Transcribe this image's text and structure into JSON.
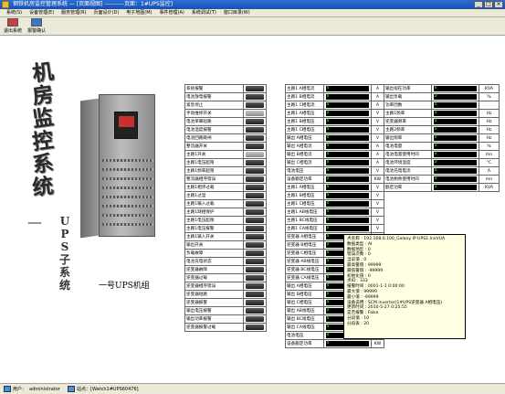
{
  "window": {
    "title": "钢铁机房监控管理系统 — [页面视图] ----------页面：1#UPS监控]",
    "min_label": "_",
    "max_label": "□",
    "close_label": "×"
  },
  "menu": [
    "系统(S)",
    "设备管理(E)",
    "服务管理(R)",
    "页面设计(D)",
    "电子地图(M)",
    "事件管理(A)",
    "系统调试(T)",
    "窗口目录(W)"
  ],
  "toolbar": {
    "exit_label": "退出系统",
    "alarm_label": "报警确认"
  },
  "vertical_title": [
    "机",
    "房",
    "监",
    "控",
    "系",
    "统"
  ],
  "dash": "—",
  "vertical_subtitle": [
    "U",
    "P",
    "S",
    "子",
    "系",
    "统"
  ],
  "ups_label": "一号UPS机组",
  "status_items": [
    "系统报警",
    "电池放电报警",
    "紧急停止",
    "手动维修开关",
    "电池单串短路",
    "电池温度报警",
    "电池回路跳闸",
    "整流器开关",
    "主路1开关",
    "主路1电压超限",
    "主路1频率超限",
    "整流器相序错误",
    "主路1相序过载",
    "主路1过温",
    "主路1输入过载",
    "主路1缺相保护",
    "主路1电压超限",
    "主路1电压报警",
    "主路1输入开关",
    "输出开关",
    "负载故障",
    "电池充电状态",
    "逆变器故障",
    "逆变器过载",
    "逆变器相序错误",
    "逆变器短路",
    "逆变器报警",
    "输出电压报警",
    "输出功率报警",
    "逆变器报警过载"
  ],
  "status_colors": [
    "dark",
    "dark",
    "dark",
    "gray",
    "dark",
    "dark",
    "dark",
    "dark",
    "gray",
    "dark",
    "dark",
    "dark",
    "dark",
    "dark",
    "dark",
    "dark",
    "dark",
    "dark",
    "dark",
    "dark",
    "dark",
    "dark",
    "dark",
    "dark",
    "dark",
    "dark",
    "dark",
    "dark",
    "dark",
    "dark"
  ],
  "meas_rows": [
    {
      "name": "主路1 A相电流",
      "value": "0",
      "unit": "A",
      "name2": "输出视在功率",
      "value2": "0",
      "unit2": "KVA"
    },
    {
      "name": "主路1 B相电流",
      "value": "0",
      "unit": "A",
      "name2": "输出负载",
      "value2": "0",
      "unit2": "%"
    },
    {
      "name": "主路1 C相电流",
      "value": "0",
      "unit": "A",
      "name2": "功率因数",
      "value2": "0",
      "unit2": ""
    },
    {
      "name": "主路1 A相电压",
      "value": "0",
      "unit": "V",
      "name2": "主路1频率",
      "value2": "0",
      "unit2": "Hz"
    },
    {
      "name": "主路1 B相电压",
      "value": "0",
      "unit": "V",
      "name2": "逆变器频率",
      "value2": "0",
      "unit2": "Hz"
    },
    {
      "name": "主路1 C相电压",
      "value": "0",
      "unit": "V",
      "name2": "主路2频率",
      "value2": "0",
      "unit2": "Hz"
    },
    {
      "name": "输出 A相电压",
      "value": "0",
      "unit": "V",
      "name2": "输出频率",
      "value2": "0",
      "unit2": "Hz"
    },
    {
      "name": "输出 A相电流",
      "value": "0",
      "unit": "A",
      "name2": "电池电量",
      "value2": "0",
      "unit2": "%"
    },
    {
      "name": "输出 B相电流",
      "value": "0",
      "unit": "A",
      "name2": "电池电量使用时间",
      "value2": "0",
      "unit2": "mn"
    },
    {
      "name": "输出 C相电流",
      "value": "0",
      "unit": "A",
      "name2": "电池环境温度",
      "value2": "0",
      "unit2": "°C"
    },
    {
      "name": "电池电压",
      "value": "0",
      "unit": "V",
      "name2": "电池充电电流",
      "value2": "0",
      "unit2": "A"
    },
    {
      "name": "设备额定功率",
      "value": "0",
      "unit": "KW",
      "name2": "电池剩余使用时间",
      "value2": "0",
      "unit2": "mn"
    },
    {
      "name": "主路1 A相电压",
      "value": "0",
      "unit": "V",
      "name2": "额定功率",
      "value2": "0",
      "unit2": "KVA"
    },
    {
      "name": "主路1 B相电压",
      "value": "0",
      "unit": "V",
      "name2": "",
      "value2": "",
      "unit2": ""
    },
    {
      "name": "主路1 C相电压",
      "value": "0",
      "unit": "V",
      "name2": "",
      "value2": "",
      "unit2": ""
    },
    {
      "name": "主路1 AB线电压",
      "value": "0",
      "unit": "V",
      "name2": "",
      "value2": "",
      "unit2": ""
    },
    {
      "name": "主路1 BC线电压",
      "value": "0",
      "unit": "V",
      "name2": "",
      "value2": "",
      "unit2": ""
    },
    {
      "name": "主路1 CA线电压",
      "value": "0",
      "unit": "V",
      "name2": "",
      "value2": "",
      "unit2": ""
    },
    {
      "name": "逆变器 A相电压",
      "value": "0",
      "unit": "V",
      "name2": "",
      "value2": "",
      "unit2": ""
    },
    {
      "name": "逆变器 B相电压",
      "value": "0",
      "unit": "V",
      "name2": "",
      "value2": "",
      "unit2": ""
    },
    {
      "name": "逆变器 C相电压",
      "value": "0",
      "unit": "V",
      "name2": "",
      "value2": "",
      "unit2": ""
    },
    {
      "name": "逆变器 AB线电压",
      "value": "0",
      "unit": "V",
      "name2": "",
      "value2": "",
      "unit2": ""
    },
    {
      "name": "逆变器 BC线电压",
      "value": "0",
      "unit": "V",
      "name2": "",
      "value2": "",
      "unit2": ""
    },
    {
      "name": "逆变器 CA线电压",
      "value": "0",
      "unit": "V",
      "name2": "",
      "value2": "",
      "unit2": ""
    },
    {
      "name": "输出 A相电压",
      "value": "0",
      "unit": "V",
      "name2": "",
      "value2": "",
      "unit2": ""
    },
    {
      "name": "输出 B相电压",
      "value": "0",
      "unit": "V",
      "name2": "",
      "value2": "",
      "unit2": ""
    },
    {
      "name": "输出 C相电压",
      "value": "0",
      "unit": "V",
      "name2": "",
      "value2": "",
      "unit2": ""
    },
    {
      "name": "输出 AB线电压",
      "value": "0",
      "unit": "V",
      "name2": "",
      "value2": "",
      "unit2": ""
    },
    {
      "name": "输出 BC线电压",
      "value": "0",
      "unit": "V",
      "name2": "",
      "value2": "",
      "unit2": ""
    },
    {
      "name": "输出 CA线电压",
      "value": "0",
      "unit": "V",
      "name2": "",
      "value2": "",
      "unit2": ""
    },
    {
      "name": "电池电压",
      "value": "0",
      "unit": "V",
      "name2": "",
      "value2": "",
      "unit2": ""
    },
    {
      "name": "设备额定功率",
      "value": "0",
      "unit": "KW",
      "name2": "",
      "value2": "",
      "unit2": ""
    }
  ],
  "tooltip": [
    "点名称  : 192.168.0.100_Galaxy IP UPS1.InvVUA",
    "数据类型 : AI",
    "数据地区 : 0",
    "错误次数 : 0",
    "当前值 : 0",
    "最高警值 : 99999",
    "最低警值 : -99999",
    "初始化值 : 0",
    "点ID : 333",
    "报警时间 : 0001-1-1 0:00:00",
    "最大值 : 99999",
    "最小值 : -99999",
    "设备说明 : SCM inverter(1#UPS逆变器 A相电压)",
    "更新时间 : 2010-5-27 0:25:55",
    "是否报警 : False",
    "分段值 : 10",
    "分段表 : 20"
  ],
  "statusbar": {
    "user_label": "用户：",
    "user": "administrator",
    "node_label": "站点：",
    "node": "[Watch1#UPS60476]"
  }
}
